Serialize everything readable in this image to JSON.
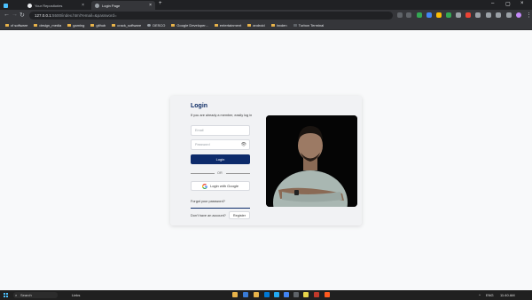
{
  "browser": {
    "tabs": [
      {
        "title": ""
      },
      {
        "title": "Your Repositories"
      },
      {
        "title": "Login Page"
      }
    ],
    "new_tab": "+",
    "address": {
      "host": "127.0.0.1",
      "path": ":5500/index.html?email=&password="
    },
    "bookmarks": [
      "cf software",
      "design_media",
      "gaming",
      "github",
      "crack_software",
      "DESCO",
      "Google Developer...",
      "entertainment",
      "android",
      "Inxden",
      "Turbon Terminal"
    ]
  },
  "login": {
    "title": "Login",
    "subtitle": "If you are already a member, easily log in",
    "email_placeholder": "Email",
    "password_placeholder": "Password",
    "login_label": "Login",
    "or_label": "OR",
    "google_label": "Login with Google",
    "forgot_label": "Forgot your password?",
    "no_account_label": "Don't have an account?",
    "register_label": "Register"
  },
  "taskbar": {
    "search_placeholder": "Search",
    "weather_text": "Links",
    "time": "11:40 AM",
    "lang": "ENG"
  },
  "colors": {
    "accent": "#0d2b6b",
    "title": "#0b2a63"
  }
}
